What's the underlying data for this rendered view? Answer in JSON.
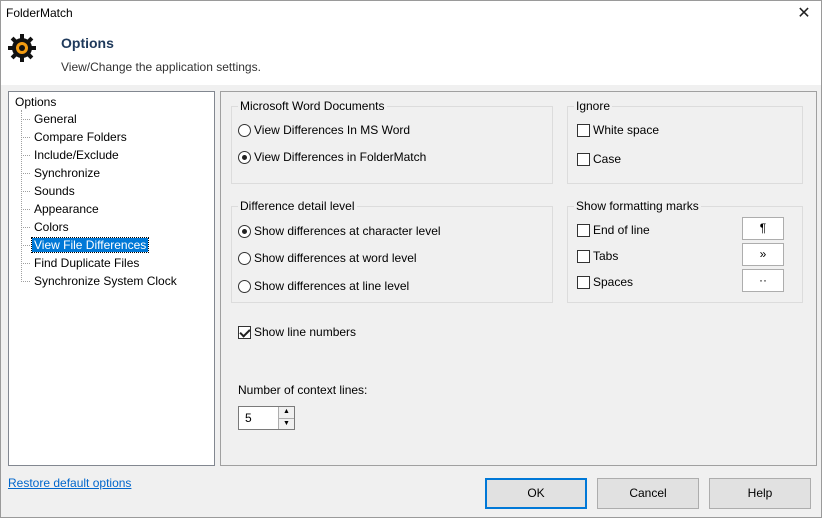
{
  "window": {
    "title": "FolderMatch",
    "close_label": "✕"
  },
  "header": {
    "title": "Options",
    "subtitle": "View/Change the application settings.",
    "icon": "gear-icon"
  },
  "tree": {
    "root": "Options",
    "items": [
      {
        "label": "General"
      },
      {
        "label": "Compare Folders"
      },
      {
        "label": "Include/Exclude"
      },
      {
        "label": "Synchronize"
      },
      {
        "label": "Sounds"
      },
      {
        "label": "Appearance"
      },
      {
        "label": "Colors"
      },
      {
        "label": "View File Differences",
        "selected": true
      },
      {
        "label": "Find Duplicate Files"
      },
      {
        "label": "Synchronize System Clock"
      }
    ]
  },
  "word_docs": {
    "title": "Microsoft Word Documents",
    "options": [
      "View Differences In MS Word",
      "View Differences in FolderMatch"
    ],
    "selected": 1
  },
  "ignore": {
    "title": "Ignore",
    "white_space": "White space",
    "case": "Case",
    "white_space_checked": false,
    "case_checked": false
  },
  "detail_level": {
    "title": "Difference detail level",
    "options": [
      "Show differences at character level",
      "Show differences at word level",
      "Show differences at line level"
    ],
    "selected": 0
  },
  "formatting_marks": {
    "title": "Show formatting marks",
    "end_of_line": "End of line",
    "tabs": "Tabs",
    "spaces": "Spaces",
    "end_of_line_symbol": "¶",
    "tabs_symbol": "»",
    "spaces_symbol": "··",
    "end_of_line_checked": false,
    "tabs_checked": false,
    "spaces_checked": false
  },
  "line_numbers": {
    "label": "Show line numbers",
    "checked": true
  },
  "context_lines": {
    "label": "Number of context lines:",
    "value": "5",
    "up": "▲",
    "down": "▼"
  },
  "footer": {
    "restore_link": "Restore default options",
    "ok": "OK",
    "cancel": "Cancel",
    "help": "Help"
  },
  "colors": {
    "accent": "#0078d7",
    "header_title": "#1e395b",
    "link": "#0066cc"
  }
}
